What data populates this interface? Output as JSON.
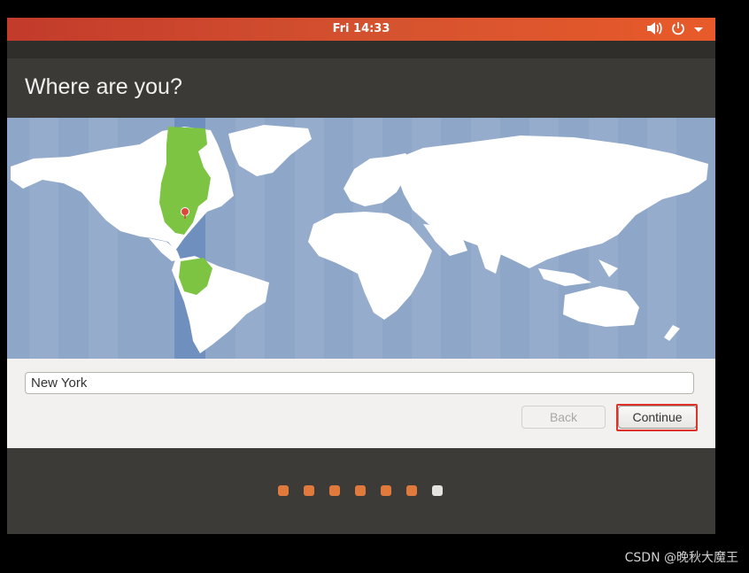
{
  "topbar": {
    "clock": "Fri 14:33",
    "icons": [
      "volume-icon",
      "power-icon",
      "menu-caret-icon"
    ]
  },
  "header": {
    "title": "Where are you?"
  },
  "map": {
    "selected_city": "New York",
    "highlight_color": "#7dc443",
    "ocean_color": "#8ea6c8",
    "land_color": "#ffffff",
    "pin_color": "#e0473c"
  },
  "form": {
    "location_value": "New York",
    "back_label": "Back",
    "continue_label": "Continue",
    "back_enabled": false
  },
  "progress": {
    "total_steps": 7,
    "current_step": 7,
    "done_color": "#e07a3c",
    "current_color": "#e4e3df"
  },
  "watermark": "CSDN @晚秋大魔王"
}
